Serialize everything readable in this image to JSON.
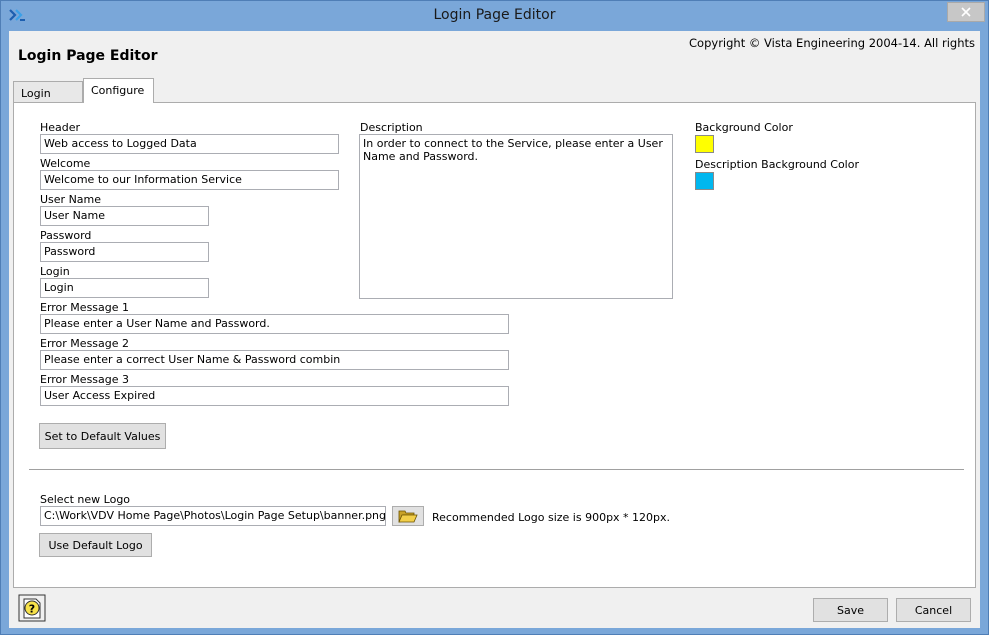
{
  "window": {
    "title": "Login Page Editor"
  },
  "header": {
    "title": "Login Page Editor",
    "copyright": "Copyright © Vista Engineering 2004-14.  All rights"
  },
  "tabs": [
    {
      "label": "Login Page",
      "active": false
    },
    {
      "label": "Configure",
      "active": true
    }
  ],
  "form": {
    "header": {
      "label": "Header",
      "value": "Web access to Logged Data"
    },
    "welcome": {
      "label": "Welcome",
      "value": "Welcome to our Information Service"
    },
    "username": {
      "label": "User Name",
      "value": "User Name"
    },
    "password": {
      "label": "Password",
      "value": "Password"
    },
    "login": {
      "label": "Login",
      "value": "Login"
    },
    "error1": {
      "label": "Error Message 1",
      "value": "Please enter a User Name and Password."
    },
    "error2": {
      "label": "Error Message 2",
      "value": "Please enter a correct User Name & Password combin"
    },
    "error3": {
      "label": "Error Message 3",
      "value": "User Access Expired"
    },
    "description": {
      "label": "Description",
      "value": "In order to connect to the Service, please enter a User Name and Password."
    },
    "background_color": {
      "label": "Background Color",
      "color": "#ffff00"
    },
    "description_background_color": {
      "label": "Description Background Color",
      "color": "#00b7ef"
    },
    "default_values_button": "Set to Default Values"
  },
  "logo": {
    "label": "Select new Logo",
    "path": "C:\\Work\\VDV Home Page\\Photos\\Login Page Setup\\banner.png",
    "recommendation": "Recommended Logo size is 900px * 120px.",
    "default_logo_button": "Use Default Logo"
  },
  "footer": {
    "save": "Save",
    "cancel": "Cancel"
  }
}
